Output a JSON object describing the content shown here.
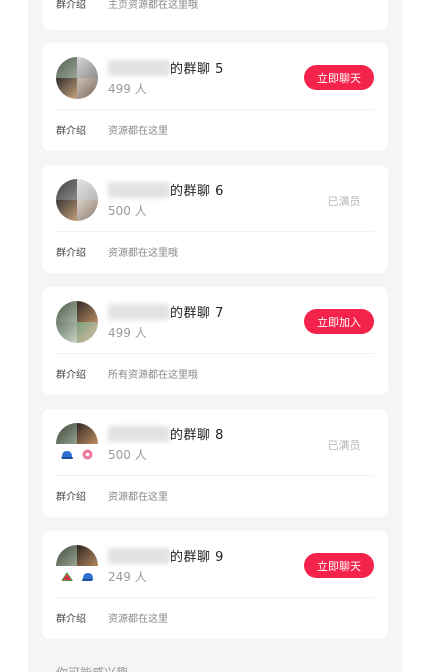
{
  "partial_card": {
    "intro_label": "群介绍",
    "intro_text": "主页资源都在这里哦"
  },
  "groups": [
    {
      "name_suffix": "的群聊 5",
      "members": "499 人",
      "action": "立即聊天",
      "intro_label": "群介绍",
      "intro_text": "资源都在这里"
    },
    {
      "name_suffix": "的群聊 6",
      "members": "500 人",
      "action": "已满员",
      "intro_label": "群介绍",
      "intro_text": "资源都在这里哦"
    },
    {
      "name_suffix": "的群聊 7",
      "members": "499 人",
      "action": "立即加入",
      "intro_label": "群介绍",
      "intro_text": "所有资源都在这里哦"
    },
    {
      "name_suffix": "的群聊 8",
      "members": "500 人",
      "action": "已满员",
      "intro_label": "群介绍",
      "intro_text": "资源都在这里"
    },
    {
      "name_suffix": "的群聊 9",
      "members": "249 人",
      "action": "立即聊天",
      "intro_label": "群介绍",
      "intro_text": "资源都在这里"
    }
  ],
  "footer": {
    "text": "你可能感兴趣"
  },
  "colors": {
    "accent": "#f3234b",
    "panel_bg": "#f5f5f5",
    "card_bg": "#ffffff",
    "disabled_text": "#b8b8b8"
  },
  "icons": {
    "member_avatar_photo": "photo-avatar",
    "member_avatar_cap": "cap-emoji-icon",
    "member_avatar_donut": "donut-emoji-icon",
    "member_avatar_watermelon": "watermelon-emoji-icon"
  }
}
